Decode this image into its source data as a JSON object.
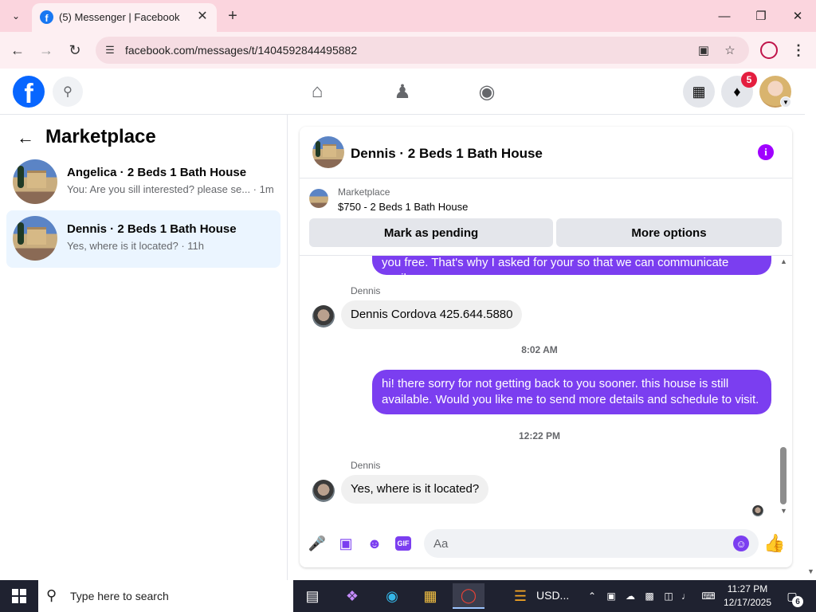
{
  "browser": {
    "tab_title": "(5) Messenger | Facebook",
    "url": "facebook.com/messages/t/1404592844495882"
  },
  "facebook": {
    "notification_count": "5"
  },
  "sidebar": {
    "title": "Marketplace",
    "conversations": [
      {
        "name": "Angelica · 2 Beds 1 Bath House",
        "snippet": "You: Are you sill interested? please se... · 1m",
        "active": false
      },
      {
        "name": "Dennis · 2 Beds 1 Bath House",
        "snippet": "Yes, where is it located? · 11h",
        "active": true
      }
    ]
  },
  "chat": {
    "title": "Dennis · 2 Beds 1 Bath House",
    "marketplace_label": "Marketplace",
    "listing": "$750 - 2 Beds 1 Bath House",
    "mark_pending_label": "Mark as pending",
    "more_options_label": "More options",
    "messages": {
      "m1_text": "you free. That's why I asked for your so that we can communicate easily.",
      "m2_sender": "Dennis",
      "m2_text": "Dennis Cordova 425.644.5880",
      "ts1": "8:02 AM",
      "m3_text": "hi! there sorry for not getting back to you sooner. this house is still available. Would you like me to send  more details and schedule to visit.",
      "ts2": "12:22 PM",
      "m4_sender": "Dennis",
      "m4_text": "Yes, where is it located?"
    },
    "composer_placeholder": "Aa"
  },
  "taskbar": {
    "search_placeholder": "Type here to search",
    "pinned_label": "USD...",
    "time": "11:27 PM",
    "date": "12/17/2025",
    "notification_count": "6"
  },
  "colors": {
    "messenger_accent": "#7b3ef0",
    "facebook_blue": "#0866ff",
    "selected_conversation": "#ebf5ff"
  },
  "icons": [
    "search-icon",
    "home-icon",
    "friends-icon",
    "groups-icon",
    "menu-grid-icon",
    "bell-icon",
    "info-icon",
    "microphone-icon",
    "photo-icon",
    "sticker-icon",
    "gif-icon",
    "emoji-icon",
    "thumbs-up-icon"
  ]
}
